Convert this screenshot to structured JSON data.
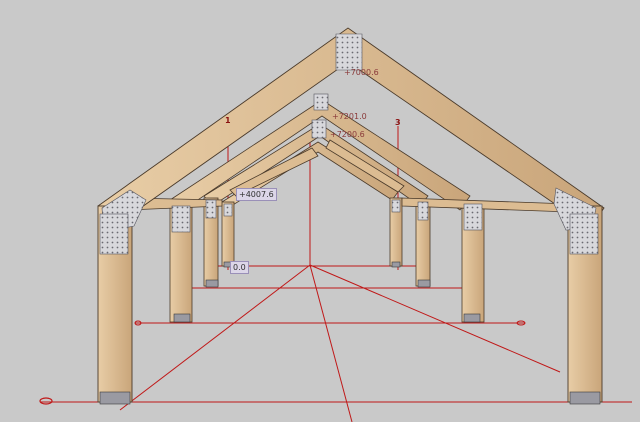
{
  "model": {
    "colors": {
      "background": "#c9c9c9",
      "timber": "#e0c29a",
      "timber_dark": "#c9a57a",
      "timber_edge": "#4a3a2a",
      "connector_plate": "#a8a8b0",
      "dimension_line": "#c01818"
    },
    "labels": {
      "ridge_elevation": "+7000.6",
      "purlin_elevation_1": "+4007.6",
      "mid_elevation_a": "+7201.0",
      "mid_elevation_b": "+7200.6",
      "left_pair_elevation": "0.0",
      "floor_level": "0.0",
      "axis_1": "1",
      "axis_3": "3"
    },
    "icons": {
      "origin_marker": "origin-marker-icon"
    }
  }
}
